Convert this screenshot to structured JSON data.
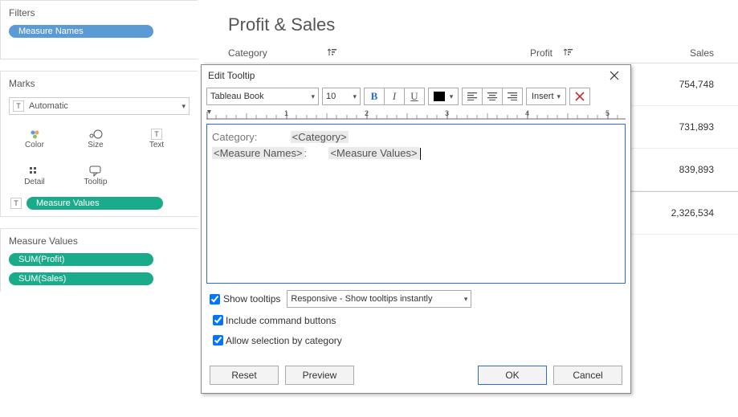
{
  "filters": {
    "title": "Filters",
    "pill": "Measure Names"
  },
  "marks": {
    "title": "Marks",
    "type": "Automatic",
    "buttons": {
      "color": "Color",
      "size": "Size",
      "text": "Text",
      "detail": "Detail",
      "tooltip": "Tooltip"
    },
    "fieldPill": "Measure Values"
  },
  "measureValues": {
    "title": "Measure Values",
    "pill1": "SUM(Profit)",
    "pill2": "SUM(Sales)"
  },
  "sheet": {
    "title": "Profit & Sales",
    "headers": {
      "category": "Category",
      "profit": "Profit",
      "sales": "Sales"
    },
    "rows": [
      {
        "sales": "754,748"
      },
      {
        "sales": "731,893"
      },
      {
        "sales": "839,893"
      },
      {
        "sales": "2,326,534"
      }
    ]
  },
  "dialog": {
    "title": "Edit Tooltip",
    "font": "Tableau Book",
    "fontSize": "10",
    "insertLabel": "Insert",
    "ruler": {
      "n1": "1",
      "n2": "2",
      "n3": "3",
      "n4": "4",
      "n5": "5"
    },
    "editor": {
      "line1_label": "Category:",
      "line1_tag": "<Category>",
      "line2_tag1": "<Measure Names>",
      "line2_colon": ":",
      "line2_tag2": "<Measure Values>"
    },
    "showTooltips": "Show tooltips",
    "tooltipMode": "Responsive - Show tooltips instantly",
    "includeCmd": "Include command buttons",
    "allowSel": "Allow selection by category",
    "btnReset": "Reset",
    "btnPreview": "Preview",
    "btnOK": "OK",
    "btnCancel": "Cancel"
  }
}
